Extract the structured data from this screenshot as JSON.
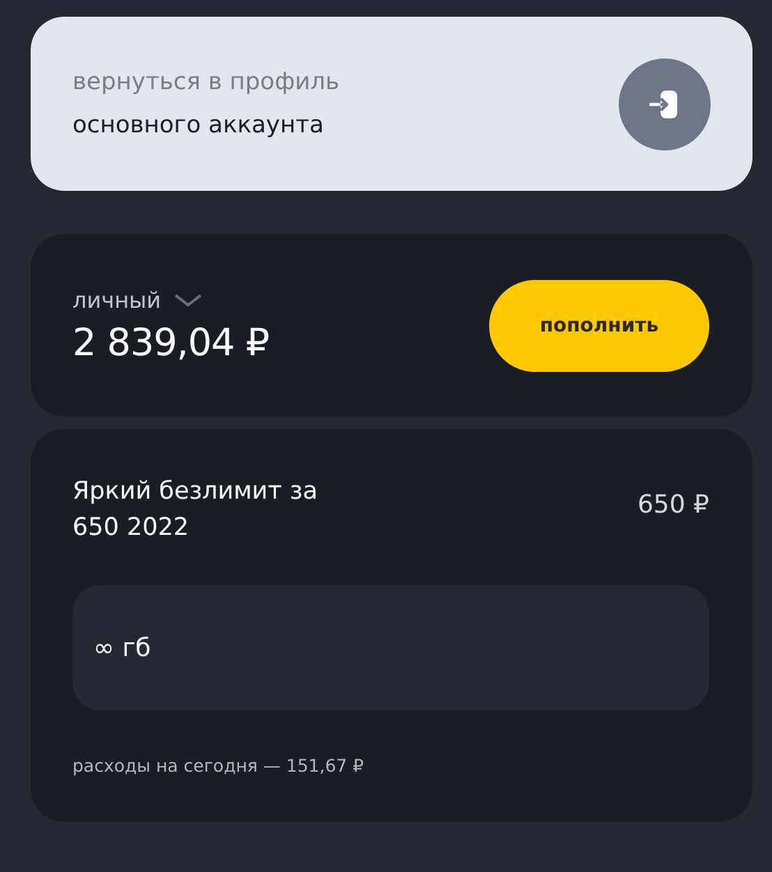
{
  "profile_card": {
    "caption": "вернуться в профиль",
    "account": "основного аккаунта"
  },
  "balance_card": {
    "account_type": "личный",
    "amount": "2 839,04 ₽",
    "top_up_button": "пополнить"
  },
  "tariff_card": {
    "name": "Яркий безлимит за 650 2022",
    "price": "650 ₽",
    "data_allowance": "∞ гб",
    "expenses_today": "расходы на сегодня — 151,67 ₽"
  }
}
